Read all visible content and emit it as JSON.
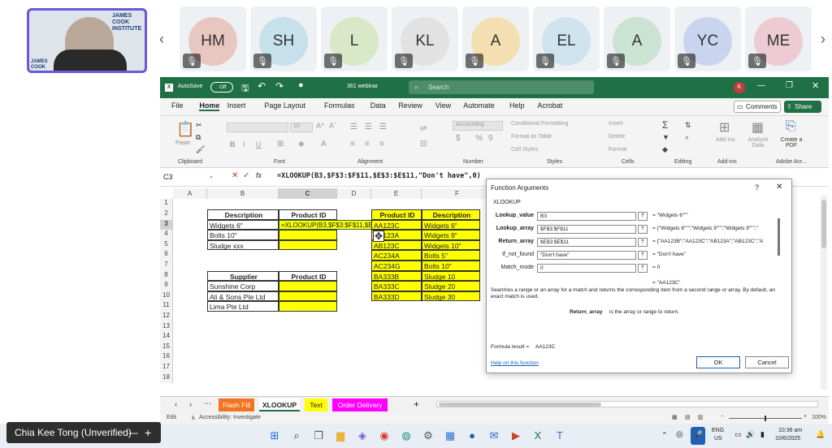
{
  "meeting": {
    "speaker_logo": "JAMES COOK INSTITUTE",
    "speaker_logo_small": "JAMES COOK INSTITUTE",
    "participants": [
      {
        "initials": "HM",
        "color": "#e8c7c0"
      },
      {
        "initials": "SH",
        "color": "#c6e0ec"
      },
      {
        "initials": "L",
        "color": "#d9e8c7"
      },
      {
        "initials": "KL",
        "color": "#e2e2e2"
      },
      {
        "initials": "A",
        "color": "#f3dfb2"
      },
      {
        "initials": "EL",
        "color": "#cfe4ef"
      },
      {
        "initials": "A",
        "color": "#cbe3d3"
      },
      {
        "initials": "YC",
        "color": "#c9d5ee"
      },
      {
        "initials": "ME",
        "color": "#eccbd3"
      }
    ],
    "self_name": "Chia Kee Tong (Unverified)"
  },
  "excel": {
    "autosave": "AutoSave",
    "autosave_state": "Off",
    "file_name": "361 webinar",
    "search_placeholder": "Search",
    "avatar_initial": "K",
    "menu": [
      "File",
      "Home",
      "Insert",
      "Page Layout",
      "Formulas",
      "Data",
      "Review",
      "View",
      "Automate",
      "Help",
      "Acrobat"
    ],
    "comments": "Comments",
    "share": "Share",
    "ribbon": {
      "paste": "Paste",
      "clipboard": "Clipboard",
      "font_size": "10",
      "font": "Font",
      "alignment": "Alignment",
      "number_format": "Accounting",
      "number": "Number",
      "cond_format": "Conditional Formatting",
      "format_table": "Format as Table",
      "cell_styles": "Cell Styles",
      "styles": "Styles",
      "insert": "Insert",
      "delete": "Delete",
      "format": "Format",
      "cells": "Cells",
      "editing": "Editing",
      "addins": "Add-ins",
      "analyze": "Analyze Data",
      "create_pdf": "Create a PDF",
      "adobe": "Adobe Acr..."
    },
    "name_box": "C3",
    "formula": "=XLOOKUP(B3,$F$3:$F$11,$E$3:$E$11,\"Don't have\",0)",
    "columns": [
      "A",
      "B",
      "C",
      "D",
      "E",
      "F"
    ],
    "rows": [
      "1",
      "2",
      "3",
      "4",
      "5",
      "6",
      "7",
      "8",
      "9",
      "10",
      "11",
      "12",
      "13",
      "14",
      "15",
      "16",
      "17",
      "18"
    ],
    "table1": {
      "h1": "Description",
      "h2": "Product ID",
      "r3": "Widgets 6\"",
      "r4": "Bolts 10\"",
      "r5": "Sludge xxx",
      "c3": "=XLOOKUP(B3,$F$3:$F$11,$E$3:$E$11,\"Don't have\",0)"
    },
    "table2": {
      "h1": "Supplier",
      "h2": "Product ID",
      "r9": "Sunshine Corp",
      "r10": "Ali & Sons Pte Ltd",
      "r11": "Lima Pte Ltd"
    },
    "lookup": {
      "h1": "Product ID",
      "h2": "Description",
      "ids": [
        "AA123C",
        "AA123A",
        "AB123C",
        "AC234A",
        "AC234G",
        "BA333B",
        "BA333C",
        "BA333D"
      ],
      "desc": [
        "Widgets 6\"",
        "Widgets 9\"",
        "Widgets 10\"",
        "Bolts 5\"",
        "Bolts 10\"",
        "Sludge 10",
        "Sludge 20",
        "Sludge 30"
      ]
    },
    "sheets": [
      "Flash Fill",
      "XLOOKUP",
      "Text",
      "Order Delivery"
    ],
    "sheet_colors": [
      "#f4731f",
      "#ffffff",
      "#ffff00",
      "#ff00ff"
    ],
    "status_edit": "Edit",
    "status_access": "Accessibility: Investigate",
    "zoom": "100%"
  },
  "dialog": {
    "title": "Function Arguments",
    "function": "XLOOKUP",
    "args": [
      {
        "label": "Lookup_value",
        "value": "B3",
        "result": "\"Widgets 6\"\"\""
      },
      {
        "label": "Lookup_array",
        "value": "$F$3:$F$11",
        "result": "{\"Widgets 6\"\"\";\"Widgets 9\"\"\";\"Widgets 9\"\"\";\""
      },
      {
        "label": "Return_array",
        "value": "$E$3:$E$11",
        "result": "{\"AA123B\";\"AA123C\";\"AB123A\";\"AB123C\";\"A"
      },
      {
        "label": "If_not_found",
        "value": "\"Don't have\"",
        "result": "\"Don't have\""
      },
      {
        "label": "Match_mode",
        "value": "0",
        "result": "0"
      }
    ],
    "overall_result": "\"AA123C\"",
    "description": "Searches a range or an array for a match and returns the corresponding item from a second range or array. By default, an exact match is used.",
    "param_name": "Return_array",
    "param_desc": "is the array or range to return.",
    "formula_result_label": "Formula result =",
    "formula_result": "AA123C",
    "help": "Help on this function",
    "ok": "OK",
    "cancel": "Cancel"
  },
  "taskbar": {
    "lang": "ENG",
    "region": "US",
    "time": "10:36 am",
    "date": "10/6/2025"
  }
}
